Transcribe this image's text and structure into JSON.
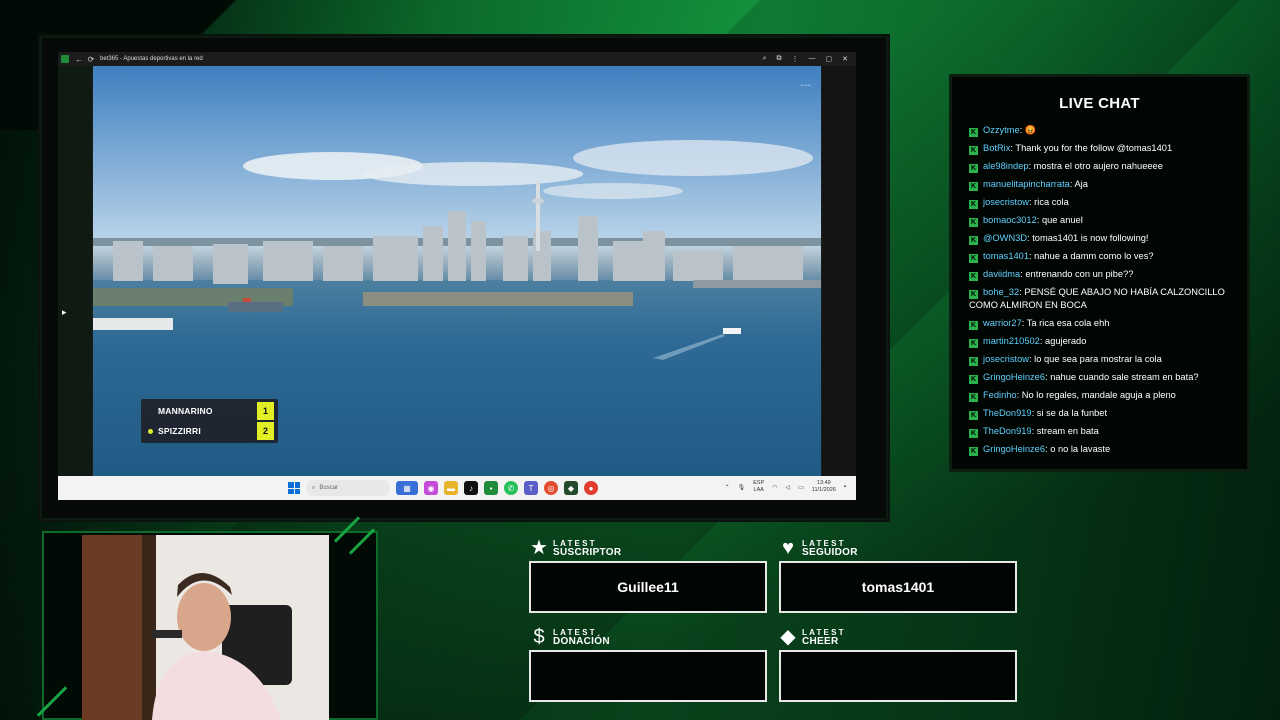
{
  "window": {
    "title": "bet365 - Apuestas deportivas en la red"
  },
  "scoreboard": {
    "players": [
      {
        "name": "MANNARINO",
        "score": "1",
        "serving": false
      },
      {
        "name": "SPIZZIRRI",
        "score": "2",
        "serving": true
      }
    ],
    "colors": {
      "score_bg": "#e2ef25",
      "panel_bg": "#1e222a"
    }
  },
  "taskbar": {
    "search_placeholder": "Buscar",
    "lang_top": "ESP",
    "lang_bottom": "LAA",
    "time": "13:49",
    "date": "11/1/2026"
  },
  "chat": {
    "title": "LIVE CHAT",
    "messages": [
      {
        "user": "Ozzytme",
        "text": "😡"
      },
      {
        "user": "BotRix",
        "text": "Thank you for the follow @tomas1401"
      },
      {
        "user": "ale98indep",
        "text": "mostra el otro aujero nahueeee"
      },
      {
        "user": "manuelitapincharrata",
        "text": "Aja"
      },
      {
        "user": "josecristow",
        "text": "rica cola"
      },
      {
        "user": "bomaoc3012",
        "text": "que anuel"
      },
      {
        "user": "@OWN3D",
        "text": "tomas1401 is now following!"
      },
      {
        "user": "tomas1401",
        "text": "nahue a damm como lo ves?"
      },
      {
        "user": "daviidma",
        "text": "entrenando con un pibe??"
      },
      {
        "user": "bohe_32",
        "text": "PENSÉ QUE ABAJO NO HABÍA CALZONCILLO COMO ALMIRON EN BOCA"
      },
      {
        "user": "warrior27",
        "text": "Ta rica esa cola ehh"
      },
      {
        "user": "martin210502",
        "text": "agujerado"
      },
      {
        "user": "josecristow",
        "text": "lo que sea para mostrar la cola"
      },
      {
        "user": "GringoHeinze6",
        "text": "nahue cuando sale stream en bata?"
      },
      {
        "user": "Fedinho",
        "text": "No lo regales, mandale aguja a pleno"
      },
      {
        "user": "TheDon919",
        "text": "si se da la funbet"
      },
      {
        "user": "TheDon919",
        "text": "stream en bata"
      },
      {
        "user": "GringoHeinze6",
        "text": "o no la lavaste"
      }
    ]
  },
  "alerts": {
    "subscriber": {
      "small": "LATEST",
      "big": "SUSCRIPTOR",
      "value": "Guillee11",
      "icon": "star-icon"
    },
    "follower": {
      "small": "LATEST",
      "big": "SEGUIDOR",
      "value": "tomas1401",
      "icon": "heart-icon"
    },
    "donation": {
      "small": "LATEST",
      "big": "DONACIÓN",
      "value": "",
      "icon": "dollar-icon"
    },
    "cheer": {
      "small": "LATEST",
      "big": "CHEER",
      "value": "",
      "icon": "diamond-icon"
    }
  },
  "colors": {
    "accent_green": "#13933c",
    "badge_green": "#2bb24c",
    "username_blue": "#5fd0ff"
  }
}
